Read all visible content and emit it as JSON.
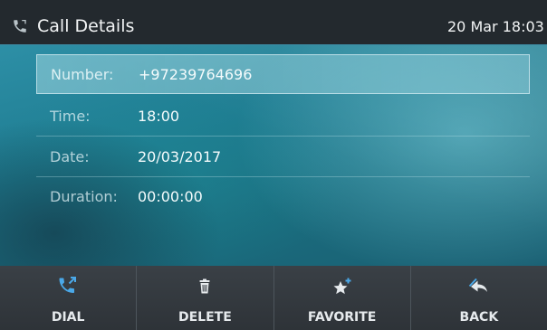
{
  "header": {
    "title": "Call Details",
    "datetime": "20 Mar 18:03",
    "icon": "phone-icon"
  },
  "details": [
    {
      "label": "Number:",
      "value": "+97239764696",
      "selected": true
    },
    {
      "label": "Time:",
      "value": "18:00",
      "selected": false
    },
    {
      "label": "Date:",
      "value": "20/03/2017",
      "selected": false
    },
    {
      "label": "Duration:",
      "value": "00:00:00",
      "selected": false
    }
  ],
  "softkeys": [
    {
      "label": "DIAL",
      "icon": "dial-icon"
    },
    {
      "label": "DELETE",
      "icon": "trash-icon"
    },
    {
      "label": "FAVORITE",
      "icon": "star-plus-icon"
    },
    {
      "label": "BACK",
      "icon": "back-arrow-icon"
    }
  ],
  "colors": {
    "topbar": "#23292e",
    "softkey_bar": "#3a4046",
    "accent_blue": "#4aa8e8",
    "background_teal": "#1f7d92"
  }
}
